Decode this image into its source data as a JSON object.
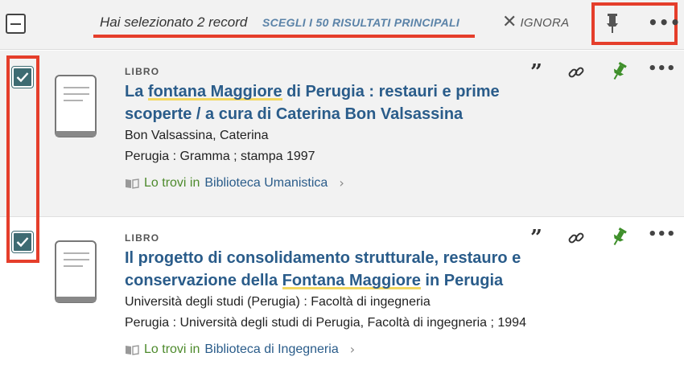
{
  "selection_bar": {
    "selected_text": "Hai selezionato 2 record",
    "select_top_link": "SCEGLI I 50 RISULTATI PRINCIPALI",
    "ignore_label": "IGNORA",
    "icons": [
      "deselect-all-icon",
      "pin-icon",
      "more-options-icon"
    ]
  },
  "results": [
    {
      "type": "LIBRO",
      "title_pre": "La ",
      "title_hl": "fontana Maggiore",
      "title_post": " di Perugia : restauri e prime scoperte / a cura di Caterina Bon Valsassina",
      "author": "Bon Valsassina, Caterina",
      "publication": "Perugia : Gramma ; stampa 1997",
      "avail_prefix": "Lo trovi in",
      "avail_location": "Biblioteca Umanistica",
      "selected": true
    },
    {
      "type": "LIBRO",
      "title_pre": "Il progetto di consolidamento strutturale, restauro e conservazione della ",
      "title_hl": "Fontana Maggiore",
      "title_post": " in Perugia",
      "author": "Università degli studi (Perugia) : Facoltà di ingegneria",
      "publication": "Perugia : Università degli studi di Perugia, Facoltà di ingegneria ; 1994",
      "avail_prefix": "Lo trovi in",
      "avail_location": "Biblioteca di Ingegneria",
      "selected": true
    }
  ],
  "actions": {
    "quote_glyph": "”",
    "more_glyph": "•••",
    "chevron": "›",
    "close_glyph": "✕"
  },
  "colors": {
    "title": "#2a5c8a",
    "availability_green": "#4d8a2c",
    "checkbox": "#3d6b72",
    "pin_green": "#3e8f2a",
    "highlight_red": "#e53e2b"
  }
}
